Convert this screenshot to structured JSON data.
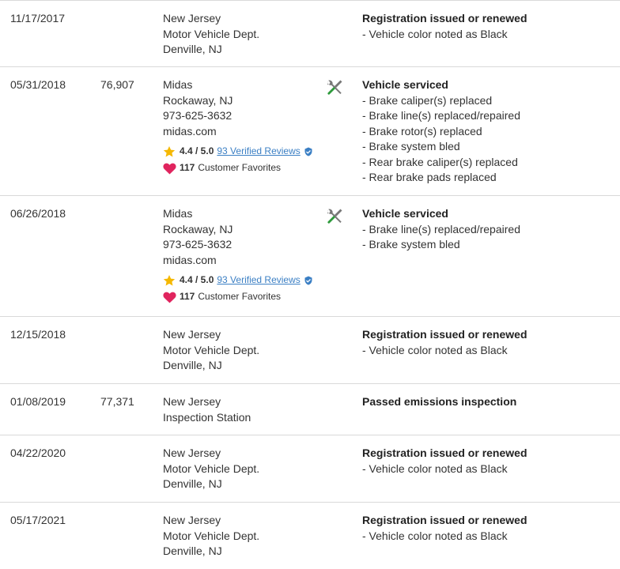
{
  "records": [
    {
      "date": "11/17/2017",
      "mileage": "",
      "source": [
        "New Jersey",
        "Motor Vehicle Dept.",
        "Denville, NJ"
      ],
      "title": "Registration issued or renewed",
      "items": [
        "- Vehicle color noted as Black"
      ]
    },
    {
      "date": "05/31/2018",
      "mileage": "76,907",
      "source": [
        "Midas",
        "Rockaway, NJ",
        "973-625-3632",
        "midas.com"
      ],
      "rating": {
        "score": "4.4 / 5.0",
        "reviews": "93 Verified Reviews"
      },
      "favorites": {
        "count": "117",
        "label": "Customer Favorites"
      },
      "icon": "wrench-screwdriver-icon",
      "title": "Vehicle serviced",
      "items": [
        "- Brake caliper(s) replaced",
        "- Brake line(s) replaced/repaired",
        "- Brake rotor(s) replaced",
        "- Brake system bled",
        "- Rear brake caliper(s) replaced",
        "- Rear brake pads replaced"
      ]
    },
    {
      "date": "06/26/2018",
      "mileage": "",
      "source": [
        "Midas",
        "Rockaway, NJ",
        "973-625-3632",
        "midas.com"
      ],
      "rating": {
        "score": "4.4 / 5.0",
        "reviews": "93 Verified Reviews"
      },
      "favorites": {
        "count": "117",
        "label": "Customer Favorites"
      },
      "icon": "wrench-screwdriver-icon",
      "title": "Vehicle serviced",
      "items": [
        "- Brake line(s) replaced/repaired",
        "- Brake system bled"
      ]
    },
    {
      "date": "12/15/2018",
      "mileage": "",
      "source": [
        "New Jersey",
        "Motor Vehicle Dept.",
        "Denville, NJ"
      ],
      "title": "Registration issued or renewed",
      "items": [
        "- Vehicle color noted as Black"
      ]
    },
    {
      "date": "01/08/2019",
      "mileage": "77,371",
      "source": [
        "New Jersey",
        "Inspection Station"
      ],
      "title": "Passed emissions inspection",
      "items": []
    },
    {
      "date": "04/22/2020",
      "mileage": "",
      "source": [
        "New Jersey",
        "Motor Vehicle Dept.",
        "Denville, NJ"
      ],
      "title": "Registration issued or renewed",
      "items": [
        "- Vehicle color noted as Black"
      ]
    },
    {
      "date": "05/17/2021",
      "mileage": "",
      "source": [
        "New Jersey",
        "Motor Vehicle Dept.",
        "Denville, NJ"
      ],
      "title": "Registration issued or renewed",
      "items": [
        "- Vehicle color noted as Black"
      ]
    }
  ],
  "colors": {
    "link": "#3b7fc4",
    "star": "#f5b800",
    "heart": "#e0245e",
    "icon_green": "#2e9a3c",
    "icon_gray": "#777777",
    "divider": "#d9d9d9"
  }
}
